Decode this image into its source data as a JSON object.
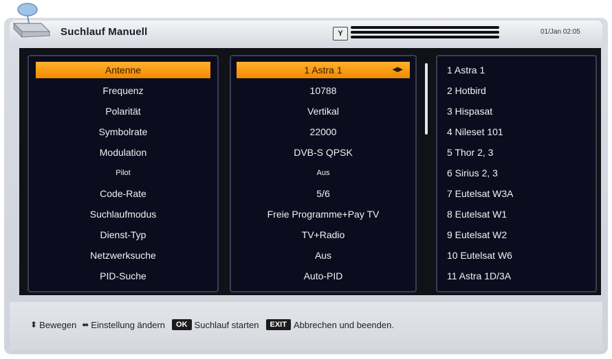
{
  "header": {
    "title": "Suchlauf Manuell",
    "signal_icon_label": "Y",
    "datetime": "01/Jan 02:05"
  },
  "settings": {
    "labels": [
      {
        "text": "Antenne",
        "small": false
      },
      {
        "text": "Frequenz",
        "small": false
      },
      {
        "text": "Polarität",
        "small": false
      },
      {
        "text": "Symbolrate",
        "small": false
      },
      {
        "text": "Modulation",
        "small": false
      },
      {
        "text": "Pilot",
        "small": true
      },
      {
        "text": "Code-Rate",
        "small": false
      },
      {
        "text": "Suchlaufmodus",
        "small": false
      },
      {
        "text": "Dienst-Typ",
        "small": false
      },
      {
        "text": "Netzwerksuche",
        "small": false
      },
      {
        "text": "PID-Suche",
        "small": false
      }
    ],
    "values": [
      {
        "text": "1 Astra 1",
        "small": false
      },
      {
        "text": "10788",
        "small": false
      },
      {
        "text": "Vertikal",
        "small": false
      },
      {
        "text": "22000",
        "small": false
      },
      {
        "text": "DVB-S QPSK",
        "small": false
      },
      {
        "text": "Aus",
        "small": true
      },
      {
        "text": "5/6",
        "small": false
      },
      {
        "text": "Freie Programme+Pay TV",
        "small": false
      },
      {
        "text": "TV+Radio",
        "small": false
      },
      {
        "text": "Aus",
        "small": false
      },
      {
        "text": "Auto-PID",
        "small": false
      }
    ],
    "selected_index": 0
  },
  "satellites": [
    "1 Astra 1",
    "2 Hotbird",
    "3 Hispasat",
    "4 Nileset 101",
    "5 Thor 2, 3",
    "6 Sirius 2, 3",
    "7 Eutelsat W3A",
    "8 Eutelsat W1",
    "9 Eutelsat W2",
    "10 Eutelsat W6",
    "11 Astra 1D/3A"
  ],
  "footer": {
    "move": "Bewegen",
    "change": "Einstellung ändern",
    "ok_key": "OK",
    "ok_action": "Suchlauf starten",
    "exit_key": "EXIT",
    "exit_action": "Abbrechen und beenden."
  },
  "colors": {
    "highlight": "#f39a10",
    "panel_bg": "#0b0d1e"
  }
}
